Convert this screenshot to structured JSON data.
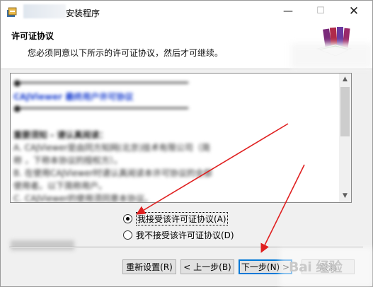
{
  "window": {
    "title": "安装程序",
    "controls": {
      "minimize": "—",
      "maximize": "☐",
      "close": "✕"
    }
  },
  "header": {
    "title": "许可证协议",
    "subtitle": "您必须同意以下所示的许可证协议，然后才可继续。"
  },
  "license": {
    "lines": [
      "●━━━━━━━━━━━━━━━━━━━━━━━━━━━━━━━━━━━━━━",
      "CAJViewer 最终用户许可协议",
      "●━━━━━━━━━━━━━━━━━━━━━━━━━━━━━━━━━━━━━━",
      "",
      "重要须知 - 请认真阅读：",
      "A. CAJViewer是由同方知网(北京)技术有限公司（简",
      "称      ，下称本协议的授权方）。",
      "B. 在使用CAJViewer时请认真阅读本许可协议的全部",
      "使用者。以下简称用户。",
      "C. CAJViewer的使用须同意本协议。"
    ]
  },
  "options": {
    "accept": "我接受该许可证协议(A)",
    "decline": "我不接受该许可证协议(D)",
    "selected": "accept"
  },
  "buttons": {
    "reset": "重新设置(R)",
    "back": "< 上一步(B)",
    "next": "下一步(N) >",
    "cancel": "取消"
  },
  "watermark": "Bai 经验",
  "colors": {
    "accent": "#0078d7",
    "annotation_arrow": "#e02020",
    "license_title": "#1a3fd0"
  }
}
